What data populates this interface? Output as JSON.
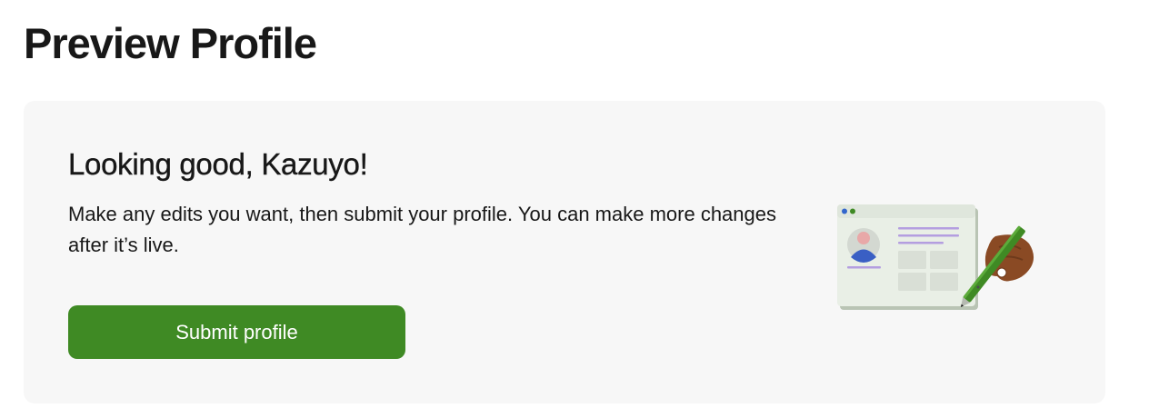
{
  "page": {
    "title": "Preview Profile"
  },
  "card": {
    "heading": "Looking good, Kazuyo!",
    "description": "Make any edits you want, then submit your profile. You can make more changes after it’s live.",
    "submit_label": "Submit profile"
  },
  "illustration": {
    "icon": "profile-edit-illustration"
  },
  "colors": {
    "accent": "#3f8a24",
    "card_background": "#f7f7f7",
    "text": "#181818"
  }
}
